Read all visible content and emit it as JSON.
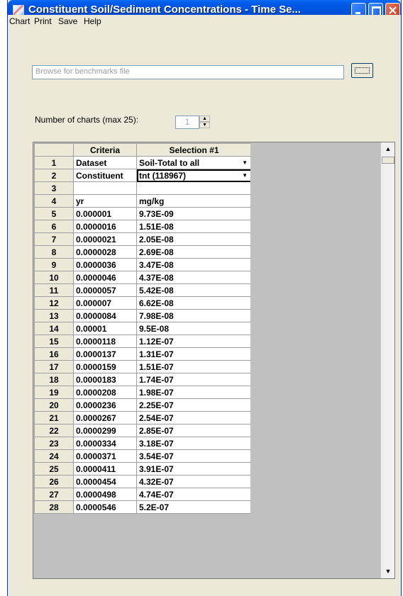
{
  "window": {
    "title": "Constituent Soil/Sediment Concentrations - Time Se..."
  },
  "menu": [
    "Chart",
    "Print",
    "Save",
    "Help"
  ],
  "benchmarks": {
    "placeholder": "Browse for benchmarks file"
  },
  "charts": {
    "label": "Number of charts (max 25):",
    "value": "1"
  },
  "grid": {
    "header": [
      "",
      "Criteria",
      "Selection #1"
    ],
    "rows": [
      {
        "n": "1",
        "a": "Dataset",
        "b": "Soil-Total to all"
      },
      {
        "n": "2",
        "a": "Constituent",
        "b": "tnt (118967)"
      },
      {
        "n": "3",
        "a": "",
        "b": ""
      },
      {
        "n": "4",
        "a": "yr",
        "b": "mg/kg"
      },
      {
        "n": "5",
        "a": "0.000001",
        "b": "9.73E-09"
      },
      {
        "n": "6",
        "a": "0.0000016",
        "b": "1.51E-08"
      },
      {
        "n": "7",
        "a": "0.0000021",
        "b": "2.05E-08"
      },
      {
        "n": "8",
        "a": "0.0000028",
        "b": "2.69E-08"
      },
      {
        "n": "9",
        "a": "0.0000036",
        "b": "3.47E-08"
      },
      {
        "n": "10",
        "a": "0.0000046",
        "b": "4.37E-08"
      },
      {
        "n": "11",
        "a": "0.0000057",
        "b": "5.42E-08"
      },
      {
        "n": "12",
        "a": "0.000007",
        "b": "6.62E-08"
      },
      {
        "n": "13",
        "a": "0.0000084",
        "b": "7.98E-08"
      },
      {
        "n": "14",
        "a": "0.00001",
        "b": "9.5E-08"
      },
      {
        "n": "15",
        "a": "0.0000118",
        "b": "1.12E-07"
      },
      {
        "n": "16",
        "a": "0.0000137",
        "b": "1.31E-07"
      },
      {
        "n": "17",
        "a": "0.0000159",
        "b": "1.51E-07"
      },
      {
        "n": "18",
        "a": "0.0000183",
        "b": "1.74E-07"
      },
      {
        "n": "19",
        "a": "0.0000208",
        "b": "1.98E-07"
      },
      {
        "n": "20",
        "a": "0.0000236",
        "b": "2.25E-07"
      },
      {
        "n": "21",
        "a": "0.0000267",
        "b": "2.54E-07"
      },
      {
        "n": "22",
        "a": "0.0000299",
        "b": "2.85E-07"
      },
      {
        "n": "23",
        "a": "0.0000334",
        "b": "3.18E-07"
      },
      {
        "n": "24",
        "a": "0.0000371",
        "b": "3.54E-07"
      },
      {
        "n": "25",
        "a": "0.0000411",
        "b": "3.91E-07"
      },
      {
        "n": "26",
        "a": "0.0000454",
        "b": "4.32E-07"
      },
      {
        "n": "27",
        "a": "0.0000498",
        "b": "4.74E-07"
      },
      {
        "n": "28",
        "a": "0.0000546",
        "b": "5.2E-07"
      }
    ]
  }
}
